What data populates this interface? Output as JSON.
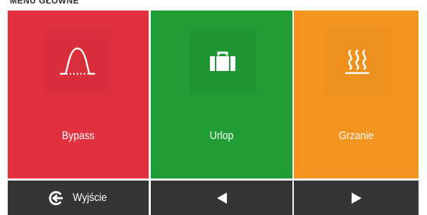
{
  "header": {
    "title": "MENU GŁÓWNE"
  },
  "tiles": [
    {
      "label": "Bypass",
      "icon": "bypass-curve-icon",
      "color": "#e1313f"
    },
    {
      "label": "Urlop",
      "icon": "suitcase-icon",
      "color": "#219d36"
    },
    {
      "label": "Grzanie",
      "icon": "heating-waves-icon",
      "color": "#f4941f"
    }
  ],
  "bottom_bar": {
    "exit_label": "Wyjście",
    "exit_icon": "exit-arrow-icon",
    "prev_icon": "triangle-left-icon",
    "next_icon": "triangle-right-icon",
    "color": "#353535"
  }
}
